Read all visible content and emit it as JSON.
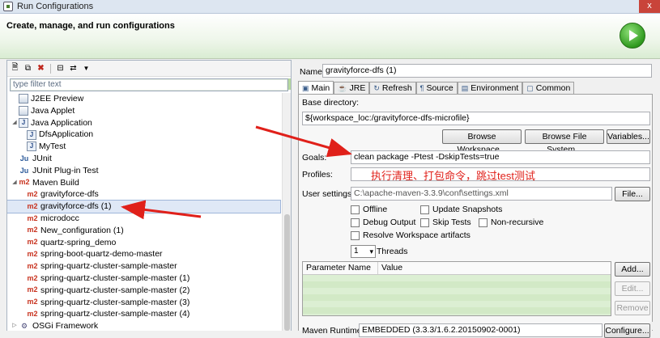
{
  "window": {
    "title": "Run Configurations",
    "close_label": "x"
  },
  "header": {
    "heading": "Create, manage, and run configurations"
  },
  "left": {
    "filter_placeholder": "type filter text",
    "tree": [
      {
        "label": "J2EE Preview",
        "icon": "grid-icon",
        "level": 1
      },
      {
        "label": "Java Applet",
        "icon": "grid-icon",
        "level": 1
      },
      {
        "label": "Java Application",
        "icon": "j-icon",
        "level": 1,
        "expanded": true
      },
      {
        "label": "DfsApplication",
        "icon": "j-icon",
        "level": 2
      },
      {
        "label": "MyTest",
        "icon": "j-icon",
        "level": 2
      },
      {
        "label": "JUnit",
        "icon": "ju-icon",
        "level": 1
      },
      {
        "label": "JUnit Plug-in Test",
        "icon": "ju-icon",
        "level": 1
      },
      {
        "label": "Maven Build",
        "icon": "m2-icon",
        "level": 1,
        "expanded": true
      },
      {
        "label": "gravityforce-dfs",
        "icon": "m2-icon",
        "level": 2
      },
      {
        "label": "gravityforce-dfs (1)",
        "icon": "m2-icon",
        "level": 2,
        "selected": true
      },
      {
        "label": "microdocc",
        "icon": "m2-icon",
        "level": 2
      },
      {
        "label": "New_configuration (1)",
        "icon": "m2-icon",
        "level": 2
      },
      {
        "label": "quartz-spring_demo",
        "icon": "m2-icon",
        "level": 2
      },
      {
        "label": "spring-boot-quartz-demo-master",
        "icon": "m2-icon",
        "level": 2
      },
      {
        "label": "spring-quartz-cluster-sample-master",
        "icon": "m2-icon",
        "level": 2
      },
      {
        "label": "spring-quartz-cluster-sample-master (1)",
        "icon": "m2-icon",
        "level": 2
      },
      {
        "label": "spring-quartz-cluster-sample-master (2)",
        "icon": "m2-icon",
        "level": 2
      },
      {
        "label": "spring-quartz-cluster-sample-master (3)",
        "icon": "m2-icon",
        "level": 2
      },
      {
        "label": "spring-quartz-cluster-sample-master (4)",
        "icon": "m2-icon",
        "level": 2
      },
      {
        "label": "OSGi Framework",
        "icon": "osgi-icon",
        "level": 1,
        "collapsed": true
      }
    ],
    "icon_glyphs": {
      "m2-icon": "m2",
      "ju-icon": "Ju",
      "j-icon": "J",
      "grid-icon": "",
      "osgi-icon": "⚙"
    }
  },
  "right": {
    "name_label": "Name:",
    "name_value": "gravityforce-dfs (1)",
    "tabs": [
      {
        "label": "Main",
        "icon": "main-icon",
        "glyph": "▣"
      },
      {
        "label": "JRE",
        "icon": "jre-icon",
        "glyph": "☕"
      },
      {
        "label": "Refresh",
        "icon": "refresh-icon",
        "glyph": "↻"
      },
      {
        "label": "Source",
        "icon": "source-icon",
        "glyph": "¶"
      },
      {
        "label": "Environment",
        "icon": "environment-icon",
        "glyph": "▤"
      },
      {
        "label": "Common",
        "icon": "common-icon",
        "glyph": "▢"
      }
    ],
    "base_dir_label": "Base directory:",
    "base_dir_value": "${workspace_loc:/gravityforce-dfs-microfile}",
    "browse_workspace": "Browse Workspace...",
    "browse_fs": "Browse File System...",
    "variables": "Variables...",
    "goals_label": "Goals:",
    "goals_value": "clean package -Ptest -DskipTests=true",
    "profiles_label": "Profiles:",
    "user_settings_label": "User settings:",
    "user_settings_value": "C:\\apache-maven-3.3.9\\conf\\settings.xml",
    "file_button": "File...",
    "checks": {
      "offline": "Offline",
      "update_snapshots": "Update Snapshots",
      "debug_output": "Debug Output",
      "skip_tests": "Skip Tests",
      "non_recursive": "Non-recursive",
      "resolve_workspace": "Resolve Workspace artifacts"
    },
    "threads_value": "1",
    "threads_label": "Threads",
    "table": {
      "col_param": "Parameter Name",
      "col_value": "Value"
    },
    "add_button": "Add...",
    "edit_button": "Edit...",
    "remove_button": "Remove",
    "maven_runtime_label": "Maven Runtime:",
    "maven_runtime_value": "EMBEDDED (3.3.3/1.6.2.20150902-0001)",
    "configure_button": "Configure..."
  },
  "annotation": {
    "text": "执行清理、打包命令，跳过test测试",
    "color": "#e0201a"
  }
}
